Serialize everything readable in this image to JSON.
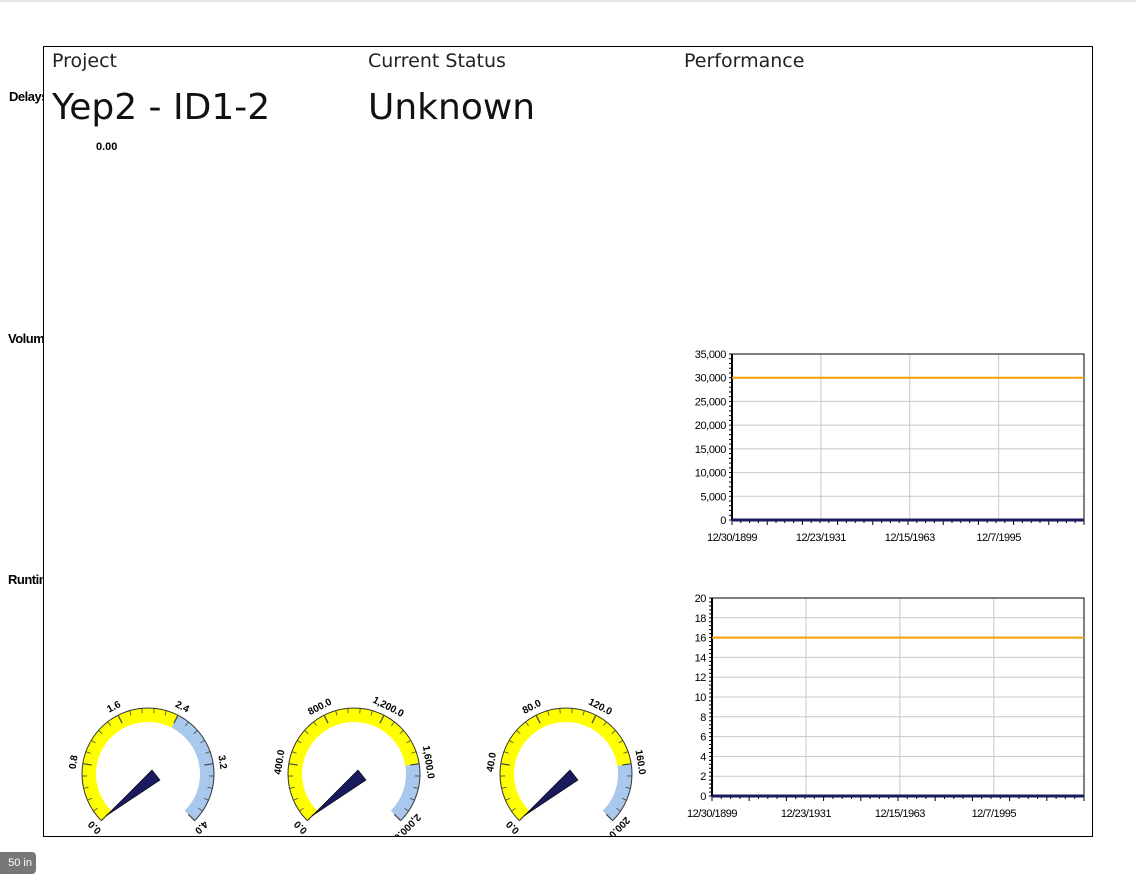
{
  "report": {
    "headers": {
      "project": "Project",
      "status": "Current Status",
      "performance": "Performance"
    },
    "project_name": "Yep2 - ID1-2",
    "current_status": "Unknown",
    "row_labels": {
      "delays": "Delays",
      "volume": "Volume/Day",
      "runtime": "Runtime/Day"
    },
    "delays_value": "0.00"
  },
  "ruler_badge": "50 in",
  "colors": {
    "target_line": "#f5a000",
    "gauge_yellow": "#ffff00",
    "gauge_blue": "#a9c8ee",
    "needle": "#1a1a5e",
    "grid": "#c8c8c8"
  },
  "chart_data": [
    {
      "type": "line",
      "name": "volume-chart",
      "x_tick_labels": [
        "12/30/1899",
        "12/23/1931",
        "12/15/1963",
        "12/7/1995"
      ],
      "y_tick_labels": [
        "35,000",
        "30,000",
        "25,000",
        "20,000",
        "15,000",
        "10,000",
        "5,000",
        "0"
      ],
      "ylim": [
        0,
        35000
      ],
      "grid": true,
      "series": [
        {
          "role": "target",
          "color": "#f5a000",
          "values": [
            30000,
            30000
          ]
        },
        {
          "role": "actual",
          "color": "#1a1a5e",
          "values": [
            0,
            0
          ]
        }
      ]
    },
    {
      "type": "line",
      "name": "runtime-chart",
      "x_tick_labels": [
        "12/30/1899",
        "12/23/1931",
        "12/15/1963",
        "12/7/1995"
      ],
      "y_tick_labels": [
        "20",
        "18",
        "16",
        "14",
        "12",
        "10",
        "8",
        "6",
        "4",
        "2",
        "0"
      ],
      "ylim": [
        0,
        20
      ],
      "grid": true,
      "series": [
        {
          "role": "target",
          "color": "#f5a000",
          "values": [
            16,
            16
          ]
        },
        {
          "role": "actual",
          "color": "#1a1a5e",
          "values": [
            0,
            0
          ]
        }
      ]
    }
  ],
  "gauges": [
    {
      "name": "gauge-delays",
      "min": 0,
      "max": 4,
      "value": 0,
      "yellow_range": [
        0,
        2.4
      ],
      "blue_range": [
        2.4,
        4
      ],
      "labels": [
        "0.0",
        "0.8",
        "1.6",
        "2.4",
        "3.2",
        "4.0"
      ]
    },
    {
      "name": "gauge-volume",
      "min": 0,
      "max": 2000,
      "value": 0,
      "yellow_range": [
        0,
        1600
      ],
      "blue_range": [
        1600,
        2000
      ],
      "labels": [
        "0.0",
        "400.0",
        "800.0",
        "1,200.0",
        "1,600.0",
        "2,000.0"
      ]
    },
    {
      "name": "gauge-runtime",
      "min": 0,
      "max": 200,
      "value": 0,
      "yellow_range": [
        0,
        160
      ],
      "blue_range": [
        160,
        200
      ],
      "labels": [
        "0.0",
        "40.0",
        "80.0",
        "120.0",
        "160.0",
        "200.0"
      ]
    }
  ]
}
